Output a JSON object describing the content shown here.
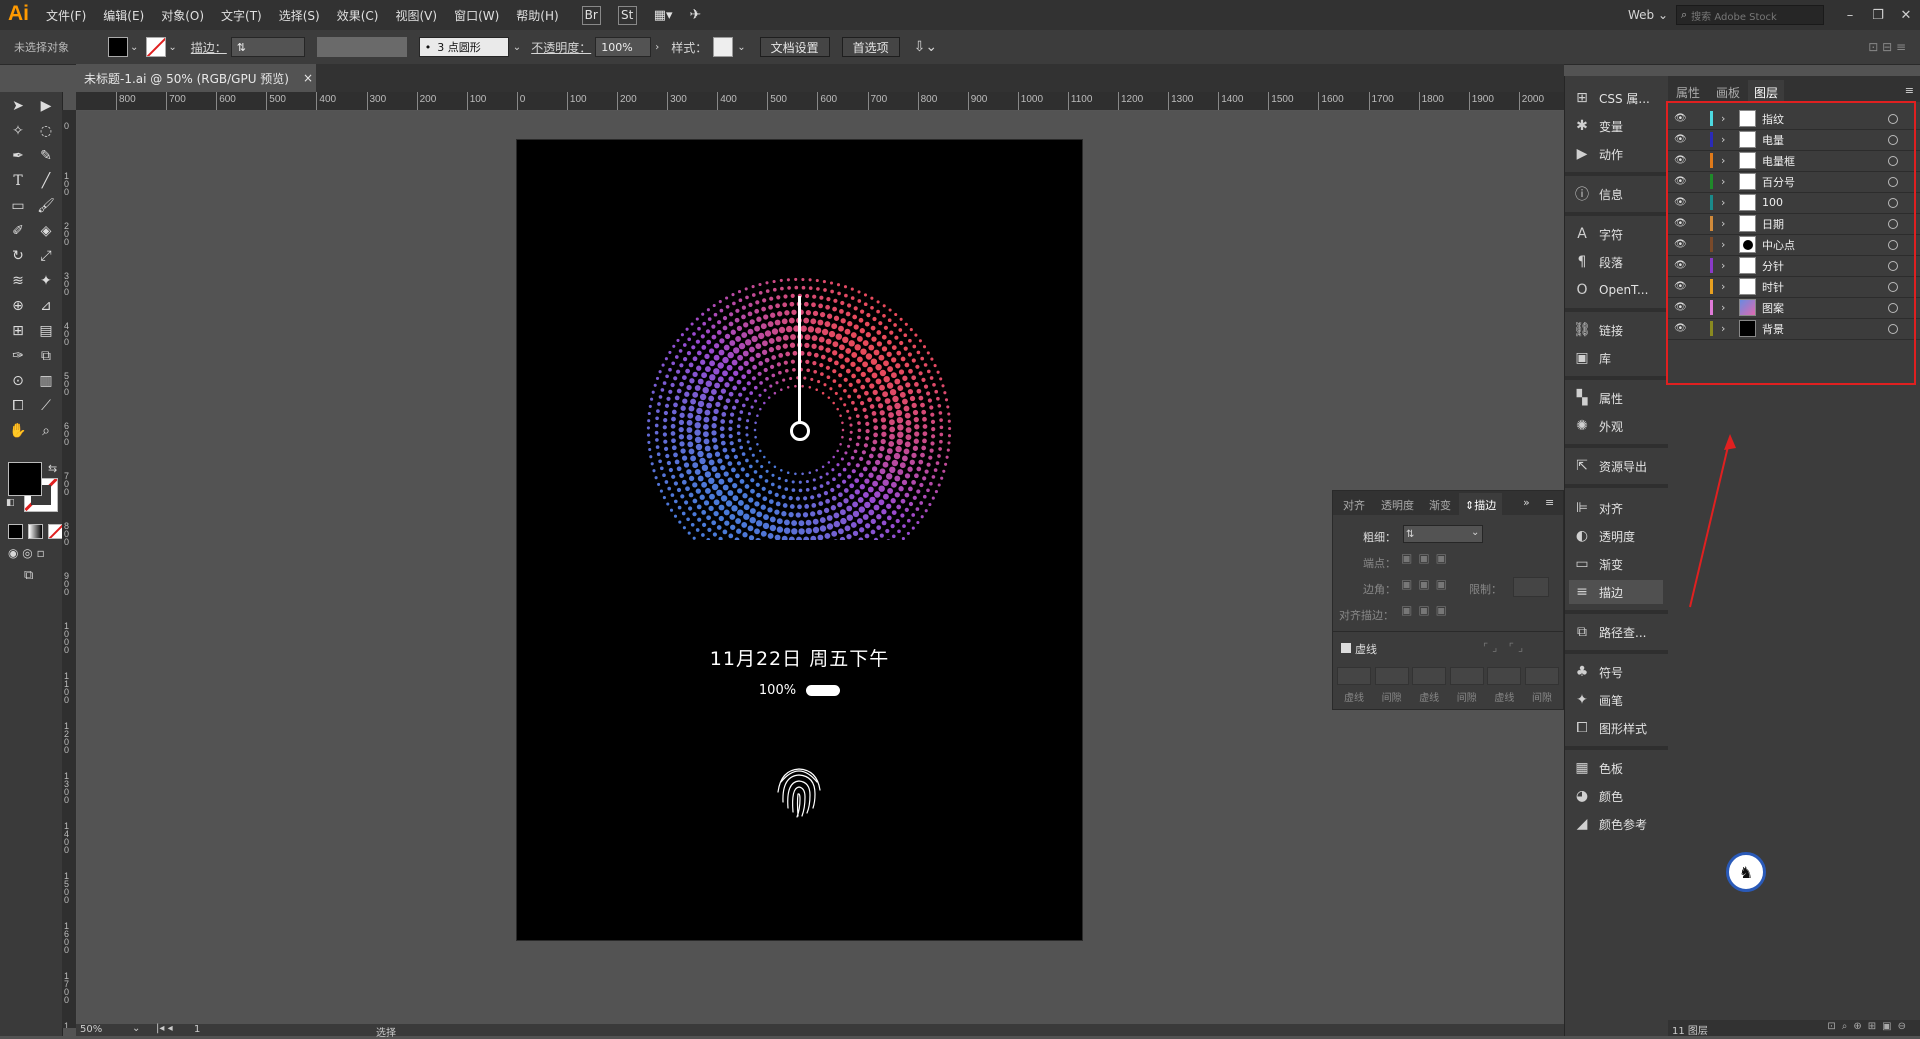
{
  "app": {
    "logo": "Ai"
  },
  "menu": [
    "文件(F)",
    "编辑(E)",
    "对象(O)",
    "文字(T)",
    "选择(S)",
    "效果(C)",
    "视图(V)",
    "窗口(W)",
    "帮助(H)"
  ],
  "menu_badges": {
    "br": "Br",
    "st": "St"
  },
  "workspace": {
    "label": "Web",
    "search_placeholder": "搜索 Adobe Stock"
  },
  "control": {
    "no_selection": "未选择对象",
    "stroke_label": "描边：",
    "brush": "3 点圆形",
    "opacity_label": "不透明度：",
    "opacity_value": "100%",
    "style_label": "样式：",
    "doc_setup": "文档设置",
    "prefs": "首选项"
  },
  "document_tab": {
    "title": "未标题-1.ai @ 50% (RGB/GPU 预览)",
    "close": "×"
  },
  "ruler_top": [
    "800",
    "700",
    "600",
    "500",
    "400",
    "300",
    "200",
    "100",
    "0",
    "100",
    "200",
    "300",
    "400",
    "500",
    "600",
    "700",
    "800",
    "900",
    "1000",
    "1100",
    "1200",
    "1300",
    "1400",
    "1500",
    "1600",
    "1700",
    "1800",
    "1900",
    "2000"
  ],
  "ruler_left": [
    "0",
    "100",
    "200",
    "300",
    "400",
    "500",
    "600",
    "700",
    "800",
    "900",
    "1000",
    "1100",
    "1200",
    "1300",
    "1400",
    "1500",
    "1600",
    "1700",
    "1800"
  ],
  "artboard": {
    "date_text": "11月22日 周五下午",
    "battery_text": "100%"
  },
  "status": {
    "zoom": "50%",
    "page": "1",
    "mode": "选择"
  },
  "icon_panel": {
    "items": [
      {
        "icon": "css-icon",
        "label": "CSS 属..."
      },
      {
        "icon": "variables-icon",
        "label": "变量"
      },
      {
        "icon": "actions-icon",
        "label": "动作"
      },
      {
        "icon": "info-icon",
        "label": "信息"
      },
      {
        "icon": "character-icon",
        "label": "字符"
      },
      {
        "icon": "paragraph-icon",
        "label": "段落"
      },
      {
        "icon": "opentype-icon",
        "label": "OpenT..."
      },
      {
        "icon": "links-icon",
        "label": "链接"
      },
      {
        "icon": "library-icon",
        "label": "库"
      },
      {
        "icon": "attributes-icon",
        "label": "属性"
      },
      {
        "icon": "appearance-icon",
        "label": "外观"
      },
      {
        "icon": "asset-export-icon",
        "label": "资源导出"
      },
      {
        "icon": "align-icon",
        "label": "对齐"
      },
      {
        "icon": "transparency-icon",
        "label": "透明度"
      },
      {
        "icon": "gradient-icon",
        "label": "渐变"
      },
      {
        "icon": "stroke-icon",
        "label": "描边"
      },
      {
        "icon": "pathfinder-icon",
        "label": "路径查..."
      },
      {
        "icon": "symbols-icon",
        "label": "符号"
      },
      {
        "icon": "brushes-icon",
        "label": "画笔"
      },
      {
        "icon": "graphic-styles-icon",
        "label": "图形样式"
      },
      {
        "icon": "swatches-icon",
        "label": "色板"
      },
      {
        "icon": "color-icon",
        "label": "颜色"
      },
      {
        "icon": "color-guide-icon",
        "label": "颜色参考"
      }
    ]
  },
  "layers_panel": {
    "tabs": [
      "属性",
      "画板",
      "图层"
    ],
    "layers": [
      {
        "name": "指纹",
        "color": "#4dd9e0"
      },
      {
        "name": "电量",
        "color": "#2a2ab8"
      },
      {
        "name": "电量框",
        "color": "#e07a1a"
      },
      {
        "name": "百分号",
        "color": "#1f8a2a"
      },
      {
        "name": "100",
        "color": "#1a8a8a"
      },
      {
        "name": "日期",
        "color": "#d08a3a"
      },
      {
        "name": "中心点",
        "color": "#7a4a2a"
      },
      {
        "name": "分针",
        "color": "#8a3ac8"
      },
      {
        "name": "时针",
        "color": "#e8a020"
      },
      {
        "name": "图案",
        "color": "#e07ad8"
      },
      {
        "name": "背景",
        "color": "#8a8a20"
      }
    ],
    "count_text": "11 图层"
  },
  "stroke_panel": {
    "tabs": [
      "对齐",
      "透明度",
      "渐变",
      "描边"
    ],
    "weight_label": "粗细：",
    "cap_label": "端点：",
    "corner_label": "边角：",
    "limit_label": "限制：",
    "align_label": "对齐描边：",
    "dashed_label": "虚线",
    "dash_cols": [
      "虚线",
      "间隙",
      "虚线",
      "间隙",
      "虚线",
      "间隙"
    ]
  },
  "colors": {
    "highlight_red": "#e02020",
    "dot_gradient_start": "#4a7ad8",
    "dot_gradient_mid": "#9a4ad0",
    "dot_gradient_end": "#e84a5a"
  }
}
